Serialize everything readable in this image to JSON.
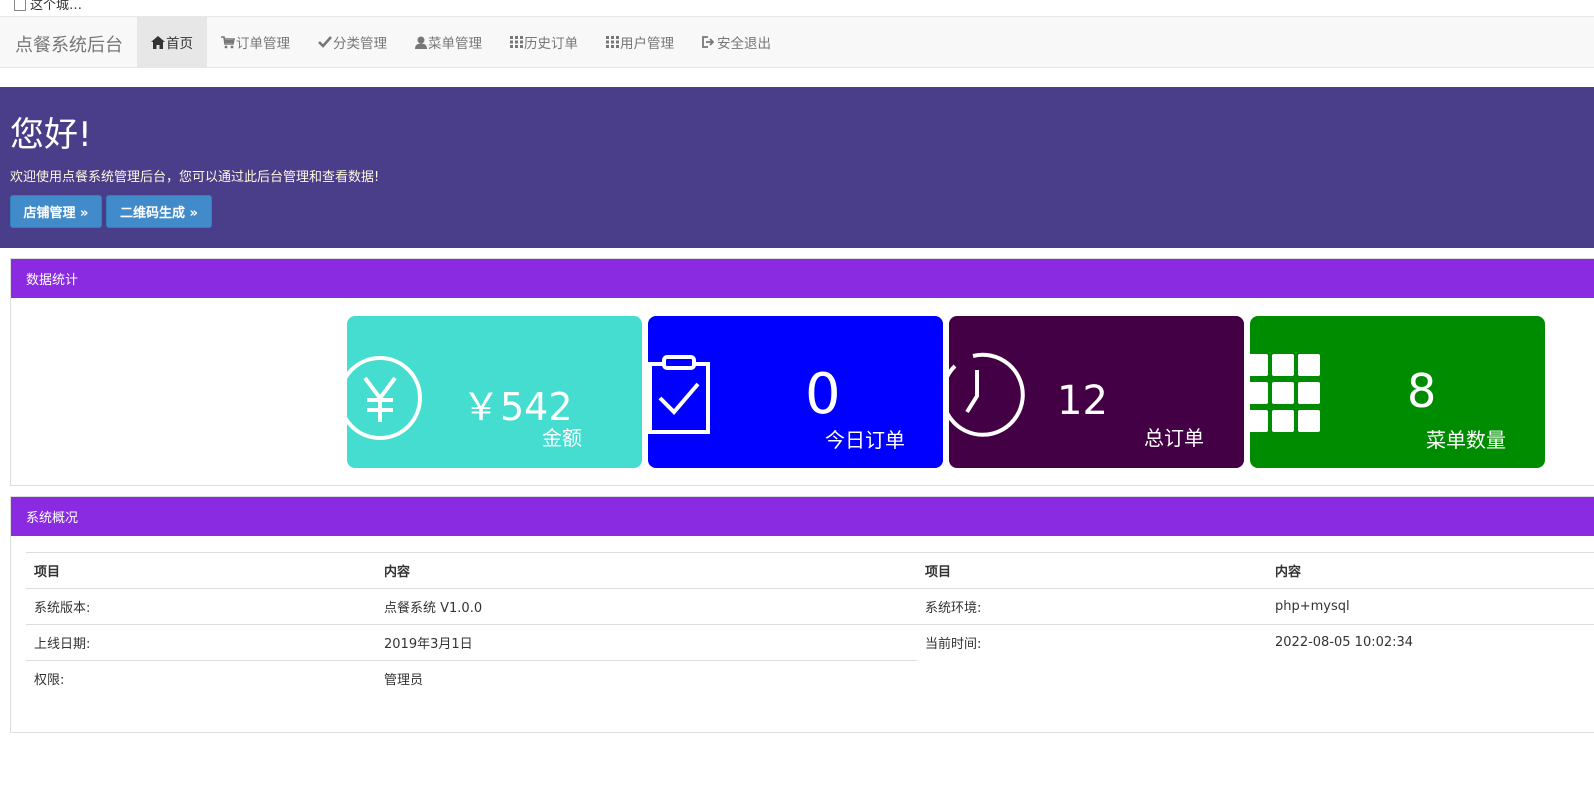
{
  "browser": {
    "tab_text": "这个城…"
  },
  "navbar": {
    "brand": "点餐系统后台",
    "items": [
      {
        "label": "首页",
        "icon": "home-icon",
        "active": true
      },
      {
        "label": "订单管理",
        "icon": "cart-icon"
      },
      {
        "label": "分类管理",
        "icon": "check-icon"
      },
      {
        "label": "菜单管理",
        "icon": "user-icon"
      },
      {
        "label": "历史订单",
        "icon": "grid-icon"
      },
      {
        "label": "用户管理",
        "icon": "grid-icon"
      },
      {
        "label": "安全退出",
        "icon": "logout-icon"
      }
    ]
  },
  "jumbotron": {
    "title": "您好!",
    "subtitle": "欢迎使用点餐系统管理后台，您可以通过此后台管理和查看数据!",
    "buttons": [
      "店铺管理 »",
      "二维码生成 »"
    ]
  },
  "stats": {
    "title": "数据统计",
    "cards": [
      {
        "value": "￥542",
        "label": "金额",
        "color": "#44ddd0",
        "icon": "yen-icon"
      },
      {
        "value": "0",
        "label": "今日订单",
        "color": "#0000ff",
        "icon": "clipboard-check-icon"
      },
      {
        "value": "12",
        "label": "总订单",
        "color": "#430044",
        "icon": "timer-icon"
      },
      {
        "value": "8",
        "label": "菜单数量",
        "color": "#008c00",
        "icon": "grid-icon"
      }
    ]
  },
  "overview": {
    "title": "系统概况",
    "headers": [
      "项目",
      "内容",
      "项目",
      "内容"
    ],
    "rows": [
      [
        "系统版本:",
        "点餐系统 V1.0.0",
        "系统环境:",
        "php+mysql"
      ],
      [
        "上线日期:",
        "2019年3月1日",
        "当前时间:",
        "2022-08-05 10:02:34"
      ],
      [
        "权限:",
        "管理员",
        "",
        ""
      ]
    ]
  }
}
